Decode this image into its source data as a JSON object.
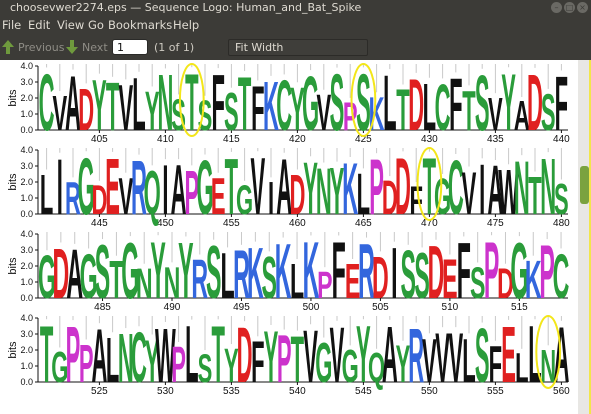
{
  "window": {
    "title": "choosevwer2274.eps — Sequence Logo: Human_and_Bat_Spike",
    "controls": [
      "minimize",
      "maximize",
      "close"
    ]
  },
  "menubar": {
    "items": [
      "File",
      "Edit",
      "View",
      "Go",
      "Bookmarks",
      "Help"
    ]
  },
  "toolbar": {
    "previous_label": "Previous",
    "next_label": "Next",
    "page_value": "1",
    "page_count": "(1 of 1)",
    "zoom_value": "Fit Width",
    "icons": [
      "arrow-up-icon",
      "arrow-down-icon"
    ]
  },
  "logo": {
    "y_axis_label": "bits",
    "y_ticks": [
      "0.0",
      "1.0",
      "2.0",
      "3.0",
      "4.0"
    ],
    "rows": [
      {
        "ticks": [
          405,
          410,
          415,
          420,
          425,
          430,
          435,
          440
        ],
        "sequence": "CVADYTVLYNSTSFSTFKCYGVSPSKLTDLCFTSVYADSF",
        "highlights": [
          412,
          425
        ]
      },
      {
        "ticks": [
          445,
          450,
          455,
          460,
          465,
          470,
          475,
          480
        ],
        "sequence": "LIRGDEVRQIAPGETGVIADYNYKLPDDFTGCVIAWNTNS",
        "highlights": [
          470
        ]
      },
      {
        "ticks": [
          485,
          490,
          495,
          500,
          505,
          510,
          515,
          520
        ],
        "sequence": "GDAGSTGNYNYRSLRKSKLKPFERDISSDEFSPDGKPC",
        "highlights": []
      },
      {
        "ticks": [
          525,
          530,
          535,
          540,
          545,
          550,
          555,
          560
        ],
        "sequence": "TGPPALNCYWPLSTYDFYPTVGVGYQAYRVVVLSFELLNA",
        "highlights": [
          559
        ]
      }
    ],
    "colors": {
      "polar": "#2a9c3a",
      "basic": "#3366dd",
      "acidic": "#e02020",
      "neutral": "#cc33cc",
      "hydrophobic": "#111111",
      "highlight": "#f3e61a"
    }
  }
}
